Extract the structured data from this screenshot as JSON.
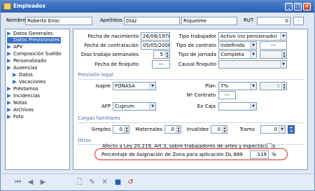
{
  "window": {
    "title": "Empleados"
  },
  "header": {
    "nombre_label": "Nombre",
    "nombre_value": "Roberto Enoc",
    "apellidos_label": "Apellidos",
    "apellido1": "Díaz",
    "apellido2": "Riquelme",
    "rut_label": "RUT",
    "rut_value": "0",
    "rut_dv": "-"
  },
  "sidebar": {
    "items": [
      {
        "label": "Datos Generales"
      },
      {
        "label": "Datos Previsionales"
      },
      {
        "label": "APV"
      },
      {
        "label": "Composición Sueldo"
      },
      {
        "label": "Personalizado"
      },
      {
        "label": "Ausencias"
      },
      {
        "label": "Datos"
      },
      {
        "label": "Vacaciones"
      },
      {
        "label": "Préstamos"
      },
      {
        "label": "Incidencias"
      },
      {
        "label": "Notas"
      },
      {
        "label": "Archivos"
      },
      {
        "label": "Foto"
      }
    ]
  },
  "form": {
    "fecha_nacimiento_label": "Fecha de nacimiento",
    "fecha_nacimiento": "26/08/1978",
    "fecha_contratacion_label": "Fecha de contratación",
    "fecha_contratacion": "05/05/2008",
    "dias_semanales_label": "Días trabajo semanales",
    "dias_semanales": "5",
    "fecha_finiquito_label": "Fecha de finiquito",
    "fecha_finiquito": "---",
    "tipo_trabajador_label": "Tipo trabajador",
    "tipo_trabajador": "Activo (no pensionado)",
    "tipo_contrato_label": "Tipo de contrato",
    "tipo_contrato": "Indefinido",
    "tipo_contrato_fecha": "---",
    "tipo_jornada_label": "Tipo de jornada",
    "tipo_jornada": "Completa",
    "causal_finiquito_label": "Causal finiquito"
  },
  "prevision": {
    "section_label": "Previsión legal",
    "isapre_label": "Isapre",
    "isapre": "FONASA",
    "plan_label": "Plan",
    "plan": "7%",
    "plan_value": "0",
    "contrato_label": "Nº Contrato",
    "contrato": "---",
    "afp_label": "AFP",
    "afp": "Cuprum",
    "excaja_label": "Ex Caja"
  },
  "cargas": {
    "section_label": "Cargas familiares",
    "simples_label": "Simples",
    "simples": "0",
    "maternales_label": "Maternales",
    "maternales": "0",
    "invalidez_label": "Invalidez",
    "invalidez": "0",
    "tramo_label": "Tramo",
    "tramo": "0"
  },
  "otros": {
    "section_label": "Otros",
    "afecto_label": "Afecto a Ley 20.219, Art.3, sobre trabajadores de artes y espectáculos",
    "porcentaje_label": "Porcentaje de Asignación de Zona para aplicación DL 889",
    "porcentaje": "119",
    "porcentaje_unit": "%"
  },
  "toolbar": {
    "icons": [
      "first-icon",
      "prev-icon",
      "next-icon",
      "new-icon",
      "edit-icon",
      "delete-icon",
      "save-icon",
      "undo-icon"
    ]
  }
}
